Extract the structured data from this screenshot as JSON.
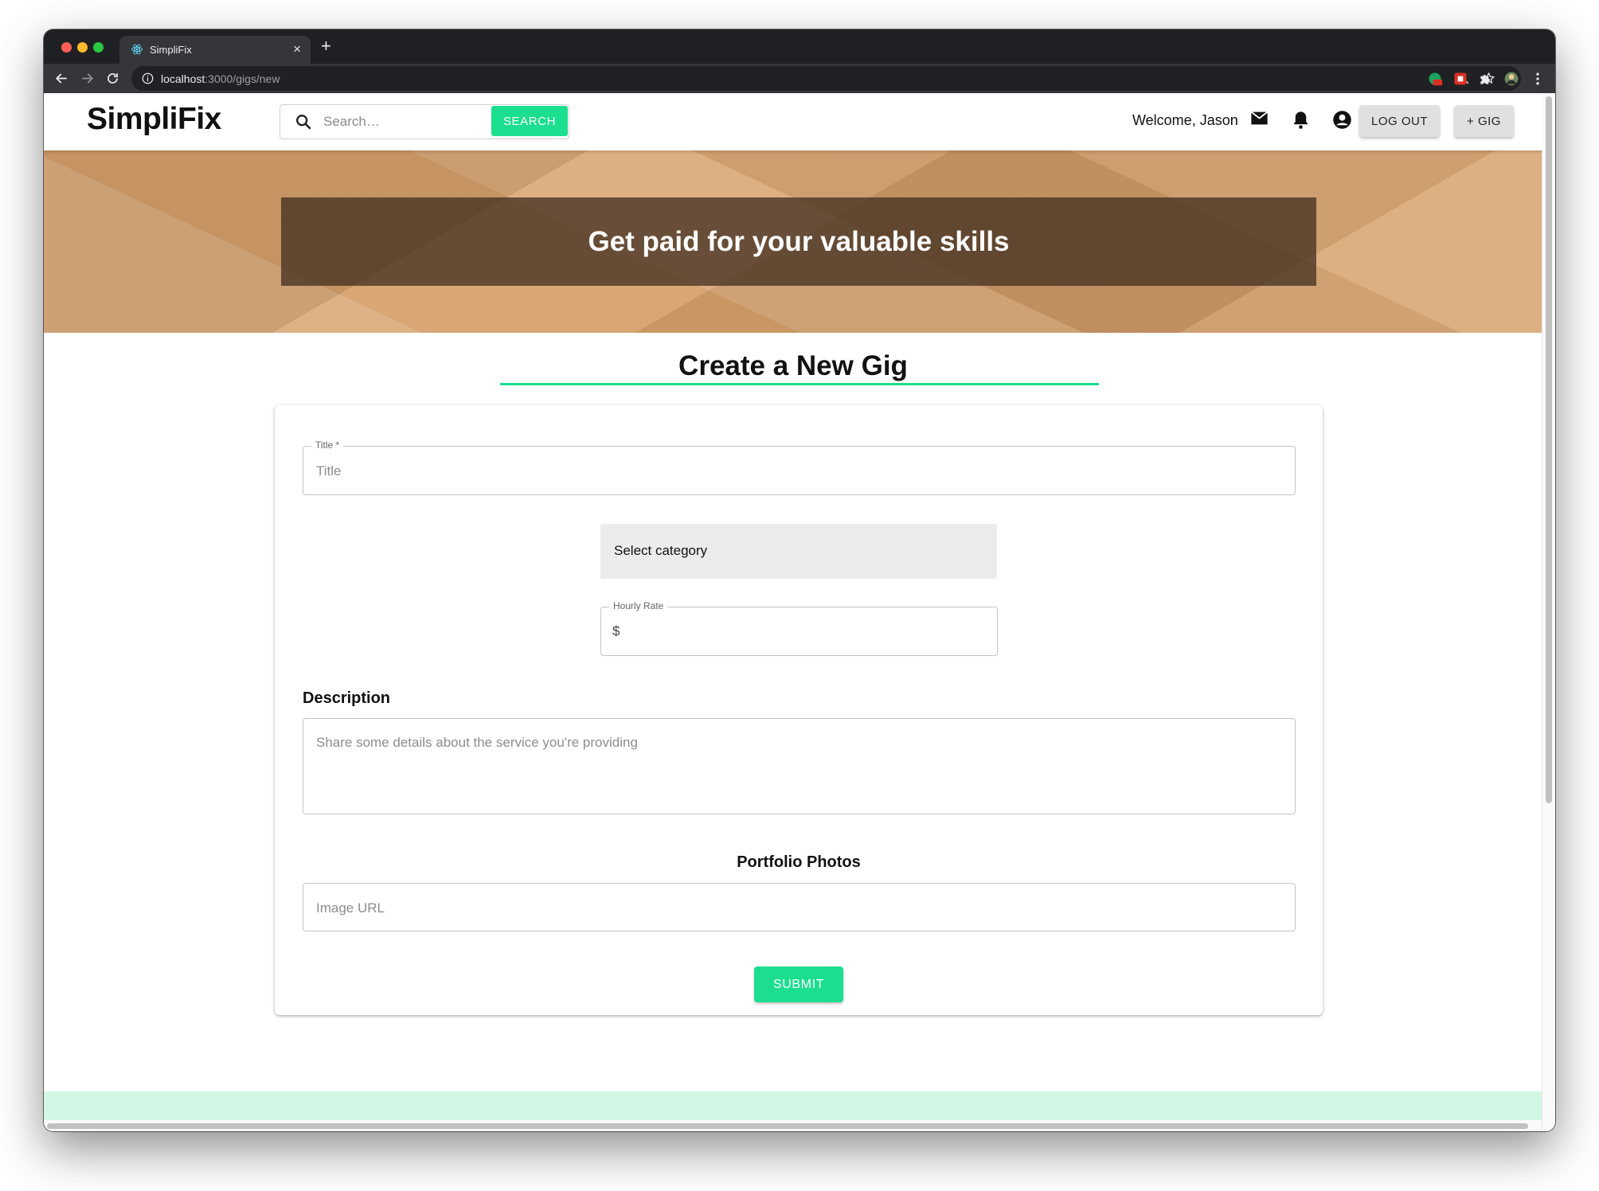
{
  "browser": {
    "tab_title": "SimpliFix",
    "tab_close": "×",
    "new_tab": "+",
    "url_host": "localhost",
    "url_path": ":3000/gigs/new"
  },
  "header": {
    "logo": "SimpliFix",
    "search_placeholder": "Search…",
    "search_button": "SEARCH",
    "welcome": "Welcome, Jason",
    "logout_button": "LOG OUT",
    "add_gig_button": "+ GIG"
  },
  "hero": {
    "tagline": "Get paid for your valuable skills"
  },
  "form": {
    "heading": "Create a New Gig",
    "title_label": "Title *",
    "title_placeholder": "Title",
    "category_select": "Select category",
    "rate_label": "Hourly Rate",
    "rate_prefix": "$",
    "description_label": "Description",
    "description_placeholder": "Share some details about the service you're providing",
    "portfolio_label": "Portfolio Photos",
    "image_url_placeholder": "Image URL",
    "submit_button": "SUBMIT"
  },
  "colors": {
    "accent": "#1bde8e",
    "footer_band": "#d2f7e5",
    "hero_overlay": "#463223"
  }
}
